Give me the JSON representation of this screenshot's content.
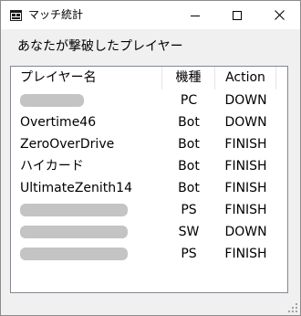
{
  "window": {
    "title": "マッチ統計",
    "minimize_icon": "minimize-icon",
    "maximize_icon": "maximize-icon",
    "close_icon": "close-icon"
  },
  "caption": "あなたが撃破したプレイヤー",
  "table": {
    "columns": [
      "プレイヤー名",
      "機種",
      "Action"
    ],
    "rows": [
      {
        "name": "",
        "redacted": true,
        "type": "PC",
        "action": "DOWN"
      },
      {
        "name": "Overtime46",
        "redacted": false,
        "type": "Bot",
        "action": "DOWN"
      },
      {
        "name": "ZeroOverDrive",
        "redacted": false,
        "type": "Bot",
        "action": "FINISH"
      },
      {
        "name": "ハイカード",
        "redacted": false,
        "type": "Bot",
        "action": "FINISH"
      },
      {
        "name": "UltimateZenith14",
        "redacted": false,
        "type": "Bot",
        "action": "FINISH"
      },
      {
        "name": "",
        "redacted": true,
        "type": "PS",
        "action": "FINISH"
      },
      {
        "name": "",
        "redacted": true,
        "type": "SW",
        "action": "DOWN"
      },
      {
        "name": "",
        "redacted": true,
        "type": "PS",
        "action": "FINISH"
      }
    ]
  },
  "colors": {
    "redaction": "#c4c4c4",
    "window_bg": "#f0f0f0",
    "list_bg": "#ffffff"
  }
}
